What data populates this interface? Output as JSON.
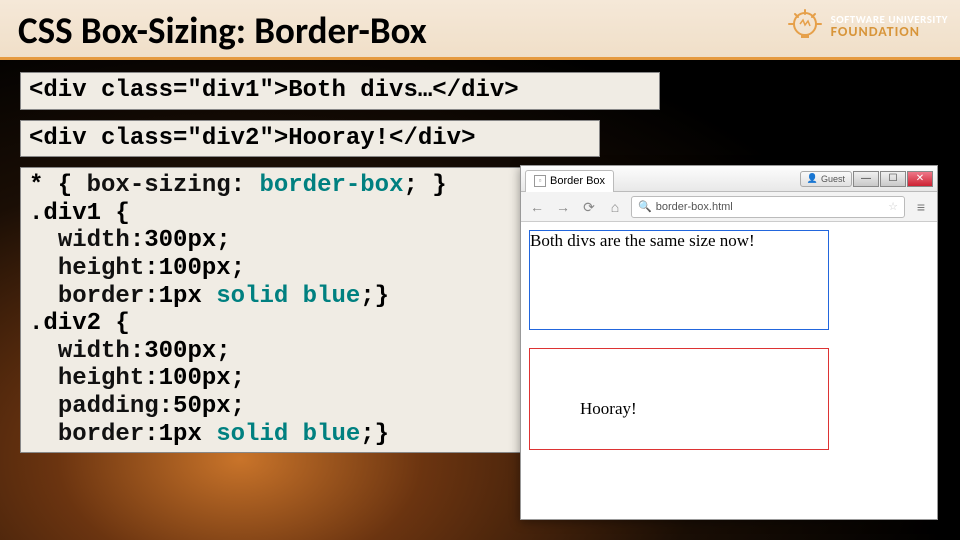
{
  "title": "CSS Box-Sizing: Border-Box",
  "logo": {
    "line1": "SOFTWARE UNIVERSITY",
    "line2": "FOUNDATION"
  },
  "code_html1": "<div class=\"div1\">Both divs…</div>",
  "code_html2": "<div class=\"div2\">Hooray!</div>",
  "code_css": "* { box-sizing: border-box; }\n.div1 {\n  width:300px;\n  height:100px;\n  border:1px solid blue;}\n.div2 {\n  width:300px;\n  height:100px;\n  padding:50px;\n  border:1px solid blue;}",
  "browser": {
    "tab_title": "Border Box",
    "guest_label": "Guest",
    "url_text": "border-box.html",
    "div1_text": "Both divs are the same size now!",
    "div2_text": "Hooray!"
  }
}
